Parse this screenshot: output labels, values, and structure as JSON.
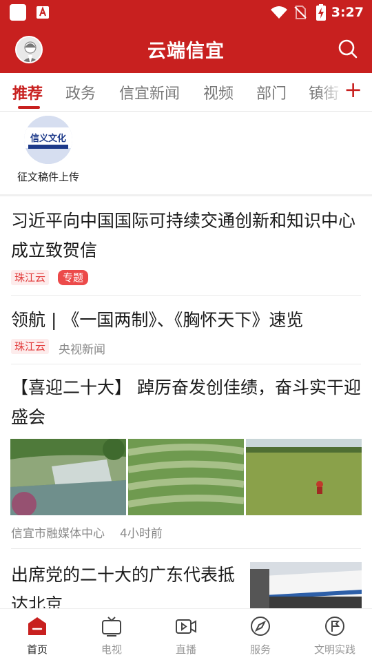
{
  "status_bar": {
    "time": "3:27",
    "icons": [
      "app-icon",
      "pdf-app-icon",
      "wifi-icon",
      "no-signal-icon",
      "battery-charging-icon"
    ]
  },
  "header": {
    "title": "云端信宜",
    "avatar_icon": "avatar",
    "search_icon": "search-icon"
  },
  "tabs": [
    {
      "label": "推荐",
      "active": true
    },
    {
      "label": "政务"
    },
    {
      "label": "信宜新闻"
    },
    {
      "label": "视频"
    },
    {
      "label": "部门"
    },
    {
      "label": "镇街"
    }
  ],
  "tab_add_label": "+",
  "quick_entry": {
    "label": "征文稿件上传",
    "logo_text": "信义文化"
  },
  "news": [
    {
      "title": "习近平向中国国际可持续交通创新和知识中心成立致贺信",
      "source_tag": "珠江云",
      "topic_tag": "专题"
    },
    {
      "title": "领航 | 《一国两制》、《胸怀天下》速览",
      "source_tag": "珠江云",
      "meta": "央视新闻"
    },
    {
      "title": "【喜迎二十大】 踔厉奋发创佳绩，奋斗实干迎盛会",
      "meta_source": "信宜市融媒体中心",
      "meta_time": "4小时前"
    },
    {
      "title": "出席党的二十大的广东代表抵达北京"
    }
  ],
  "bottom_nav": [
    {
      "label": "首页",
      "icon": "home-icon",
      "active": true
    },
    {
      "label": "电视",
      "icon": "tv-icon"
    },
    {
      "label": "直播",
      "icon": "live-video-icon"
    },
    {
      "label": "服务",
      "icon": "compass-icon"
    },
    {
      "label": "文明实践",
      "icon": "flag-icon"
    }
  ],
  "colors": {
    "brand_red": "#c8201f",
    "tag_red": "#e23b3b"
  }
}
